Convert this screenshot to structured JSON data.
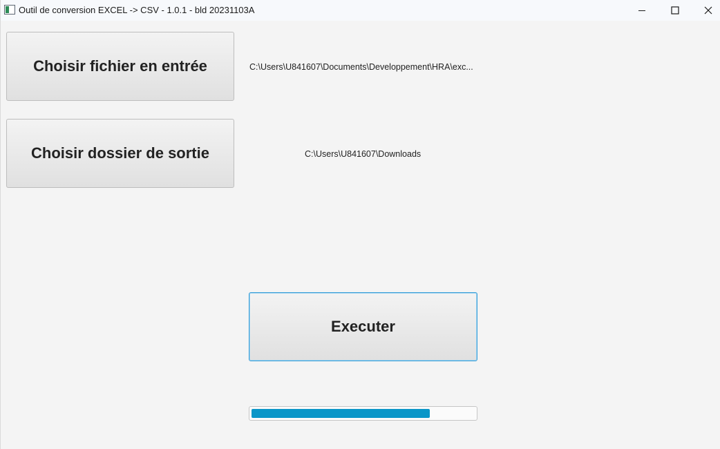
{
  "window": {
    "title": "Outil de conversion EXCEL -> CSV - 1.0.1 - bld 20231103A",
    "controls": {
      "minimize_icon": "minimize-icon",
      "maximize_icon": "maximize-icon",
      "close_icon": "close-icon"
    }
  },
  "input": {
    "button_label": "Choisir fichier en entrée",
    "path": "C:\\Users\\U841607\\Documents\\Developpement\\HRA\\exc..."
  },
  "output": {
    "button_label": "Choisir dossier de sortie",
    "path": "C:\\Users\\U841607\\Downloads"
  },
  "execute": {
    "button_label": "Executer"
  },
  "progress": {
    "value": 0.8,
    "color": "#0a96c8"
  },
  "colors": {
    "accent": "#3a9fd8",
    "background": "#f4f4f4"
  }
}
